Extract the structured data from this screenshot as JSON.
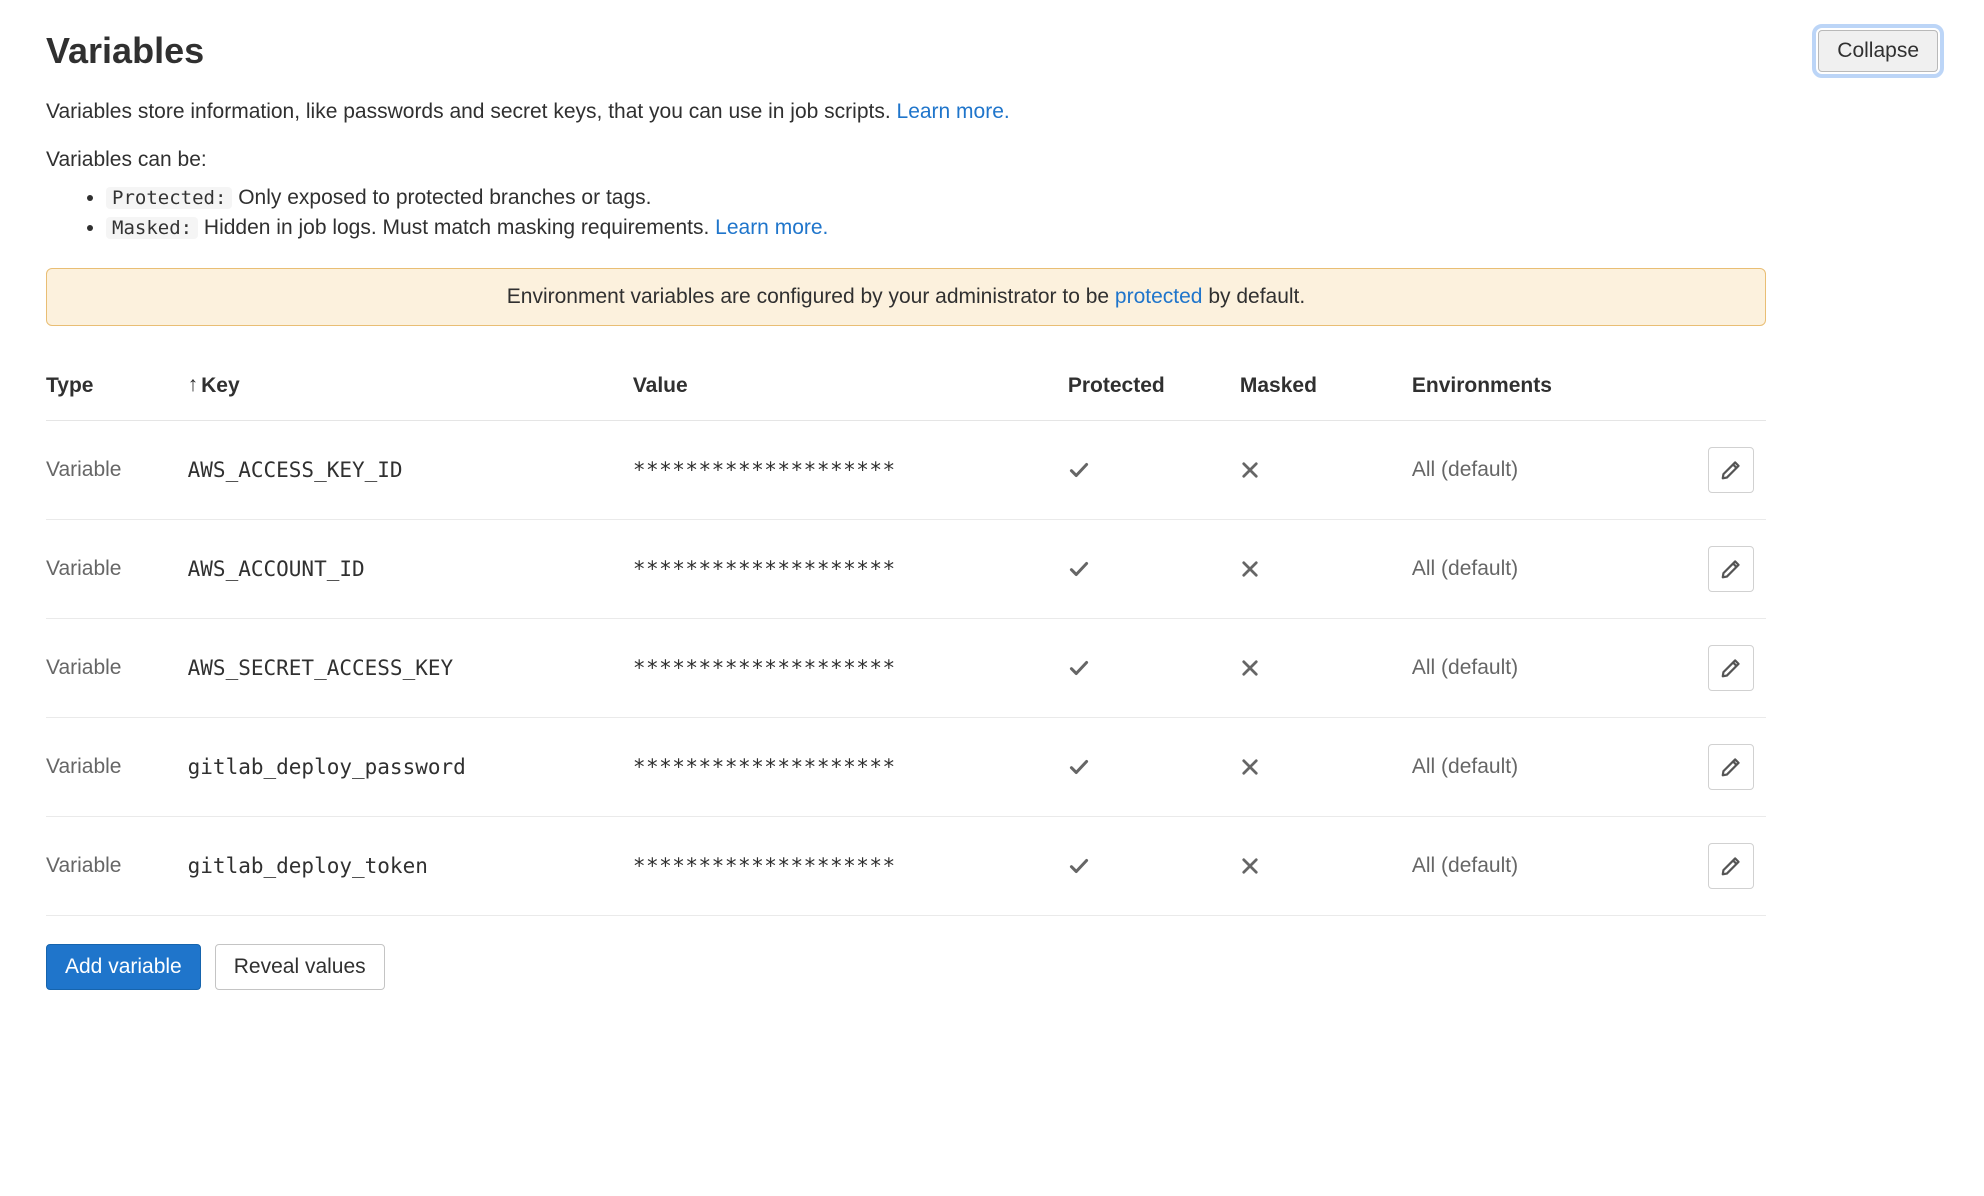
{
  "header": {
    "title": "Variables",
    "collapse_label": "Collapse"
  },
  "description": {
    "text_before_link": "Variables store information, like passwords and secret keys, that you can use in job scripts. ",
    "learn_more": "Learn more."
  },
  "types_intro": "Variables can be:",
  "types": {
    "protected_code": "Protected:",
    "protected_desc": " Only exposed to protected branches or tags.",
    "masked_code": "Masked:",
    "masked_desc": " Hidden in job logs. Must match masking requirements. ",
    "masked_link": "Learn more."
  },
  "banner": {
    "before": "Environment variables are configured by your administrator to be ",
    "link": "protected",
    "after": " by default."
  },
  "table": {
    "headers": {
      "type": "Type",
      "key": "Key",
      "value": "Value",
      "protected": "Protected",
      "masked": "Masked",
      "environments": "Environments"
    },
    "sort_indicator": "↑",
    "rows": [
      {
        "type": "Variable",
        "key": "AWS_ACCESS_KEY_ID",
        "value": "********************",
        "protected": true,
        "masked": false,
        "env": "All (default)"
      },
      {
        "type": "Variable",
        "key": "AWS_ACCOUNT_ID",
        "value": "********************",
        "protected": true,
        "masked": false,
        "env": "All (default)"
      },
      {
        "type": "Variable",
        "key": "AWS_SECRET_ACCESS_KEY",
        "value": "********************",
        "protected": true,
        "masked": false,
        "env": "All (default)"
      },
      {
        "type": "Variable",
        "key": "gitlab_deploy_password",
        "value": "********************",
        "protected": true,
        "masked": false,
        "env": "All (default)"
      },
      {
        "type": "Variable",
        "key": "gitlab_deploy_token",
        "value": "********************",
        "protected": true,
        "masked": false,
        "env": "All (default)"
      }
    ]
  },
  "actions": {
    "add": "Add variable",
    "reveal": "Reveal values"
  }
}
